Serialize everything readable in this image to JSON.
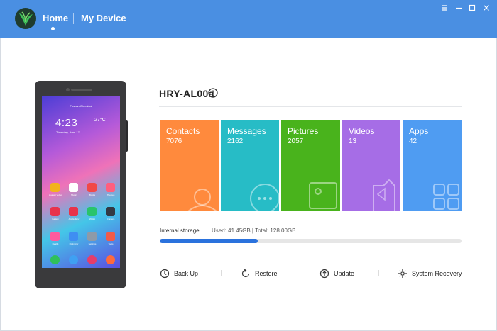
{
  "nav": {
    "home": "Home",
    "my_device": "My Device"
  },
  "window_controls": [
    "menu-icon",
    "minimize-icon",
    "maximize-icon",
    "close-icon"
  ],
  "device": {
    "model": "HRY-AL00a"
  },
  "phone_screen": {
    "status": "Foshan Chemical",
    "time": "4:23",
    "temp": "27°C",
    "date": "Thursday, June 17",
    "apps": [
      "Huawei Video",
      "Music",
      "Books",
      "Themes",
      "Gallery",
      "AppGallery",
      "Wallet",
      "Camera",
      "Health",
      "Optimizer",
      "Settings",
      "Tools"
    ]
  },
  "categories": [
    {
      "label": "Contacts",
      "count": "7076",
      "color": "#ff8a3d",
      "icon": "person-icon"
    },
    {
      "label": "Messages",
      "count": "2162",
      "color": "#27bcc6",
      "icon": "chat-bubble-icon"
    },
    {
      "label": "Pictures",
      "count": "2057",
      "color": "#49b31c",
      "icon": "picture-icon"
    },
    {
      "label": "Videos",
      "count": "13",
      "color": "#a66de6",
      "icon": "video-icon"
    },
    {
      "label": "Apps",
      "count": "42",
      "color": "#4f9cf2",
      "icon": "apps-grid-icon"
    }
  ],
  "storage": {
    "label": "Internal storage",
    "summary": "Used: 41.45GB | Total: 128.00GB",
    "used_fraction": 0.3238
  },
  "actions": [
    {
      "label": "Back Up",
      "icon": "backup-clock-icon"
    },
    {
      "label": "Restore",
      "icon": "restore-icon"
    },
    {
      "label": "Update",
      "icon": "update-arrow-icon"
    },
    {
      "label": "System Recovery",
      "icon": "gear-icon"
    }
  ]
}
